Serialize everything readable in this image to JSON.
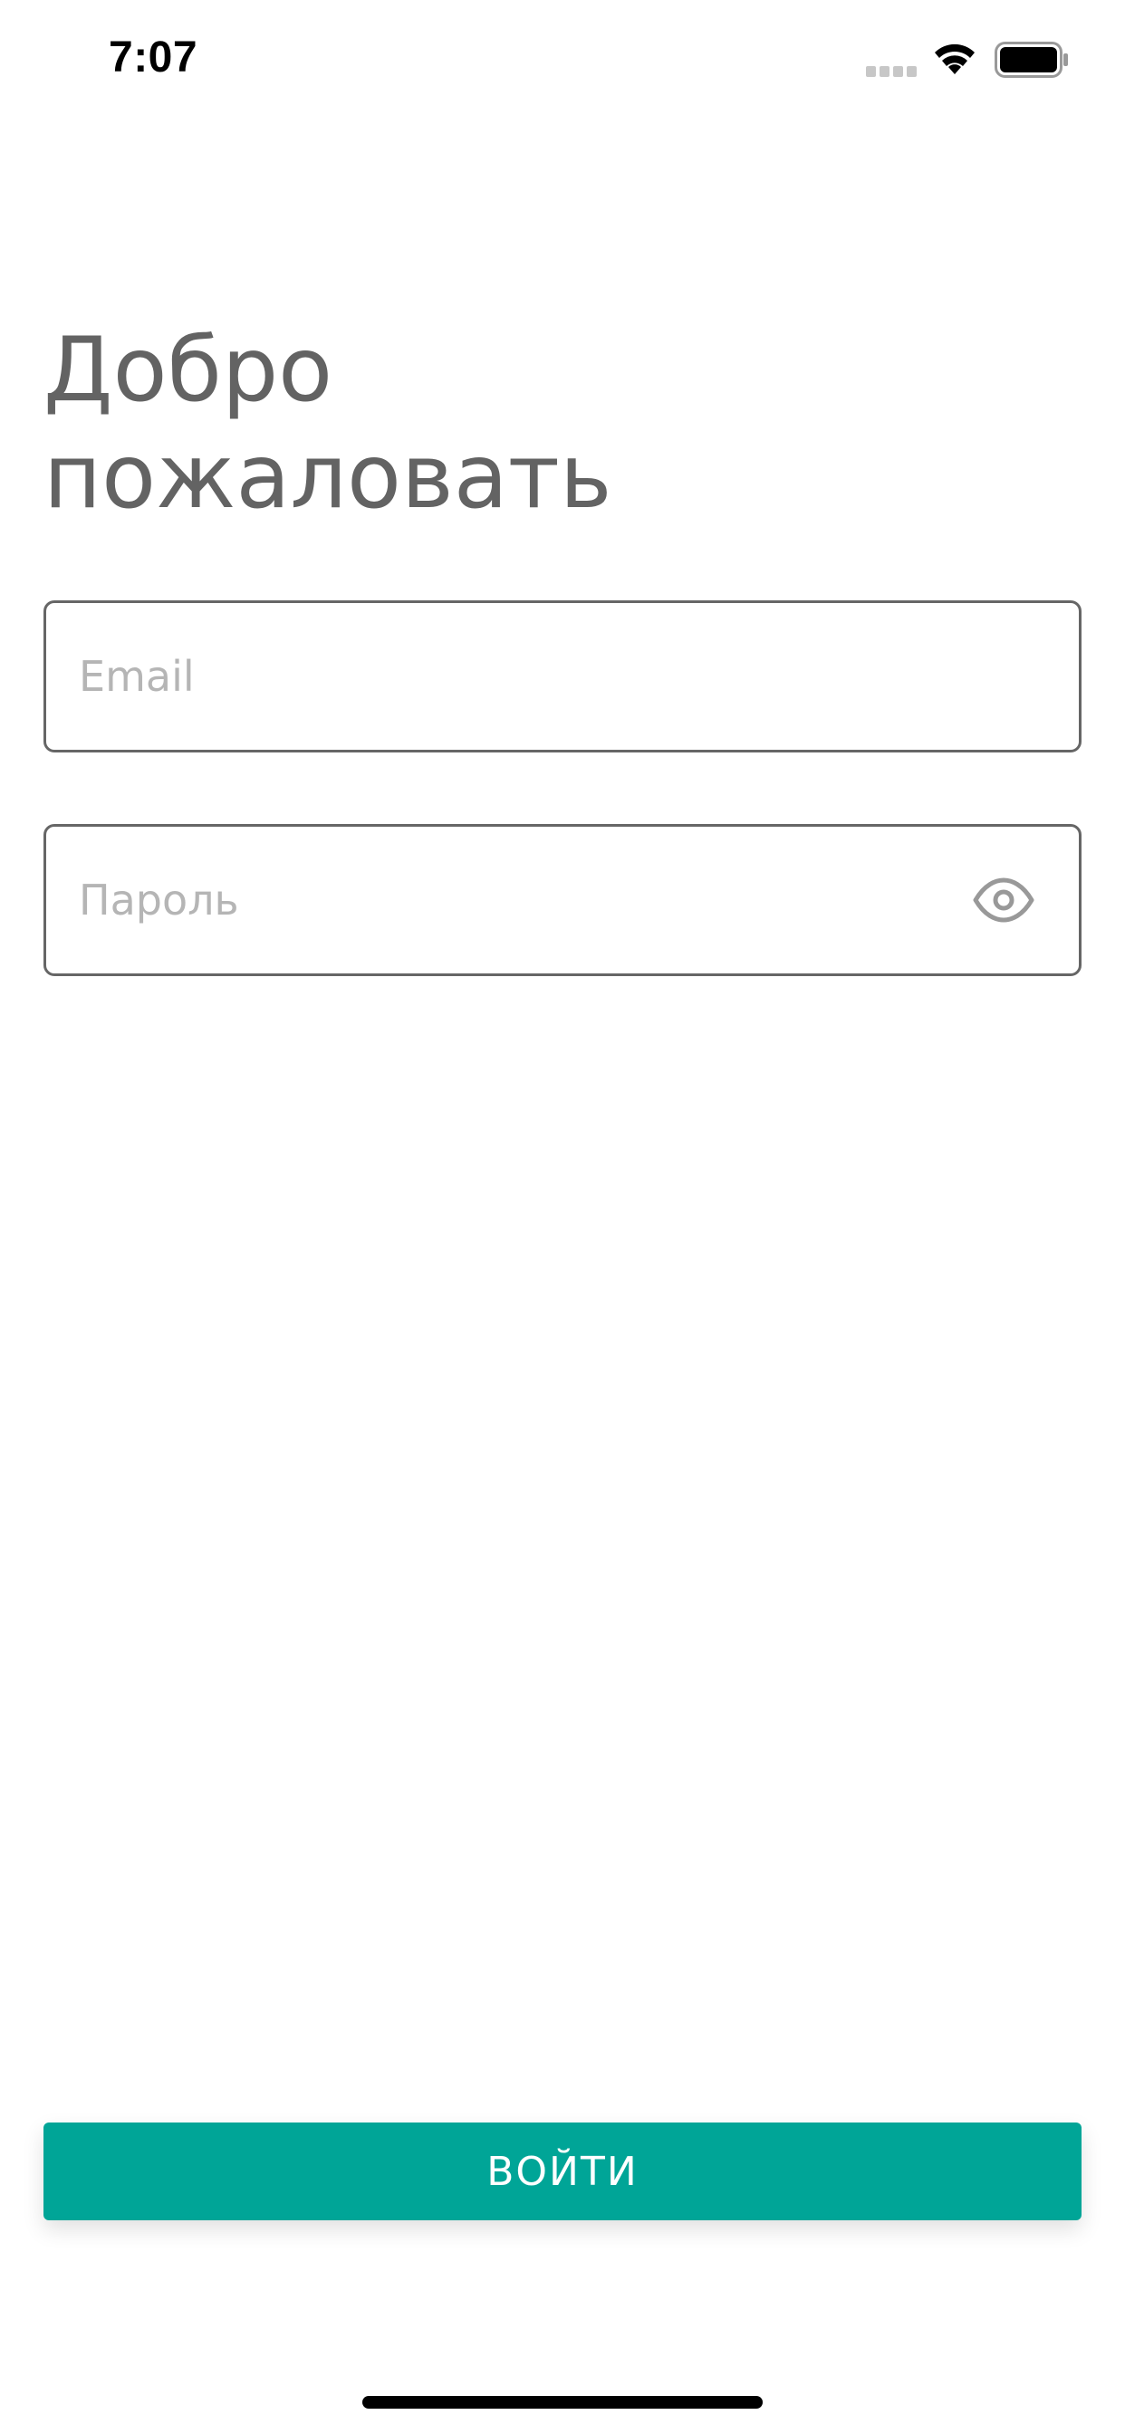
{
  "status_bar": {
    "time": "7:07",
    "icons": [
      "signal-icon",
      "wifi-icon",
      "battery-icon"
    ]
  },
  "header": {
    "title": "Добро\nпожаловать"
  },
  "form": {
    "email": {
      "placeholder": "Email",
      "value": ""
    },
    "password": {
      "placeholder": "Пароль",
      "value": "",
      "toggle_icon": "eye-icon"
    }
  },
  "actions": {
    "login_label": "ВОЙТИ"
  },
  "colors": {
    "accent": "#00a597",
    "title": "#636363",
    "field_border": "#666666",
    "placeholder": "#b5b5b5"
  }
}
